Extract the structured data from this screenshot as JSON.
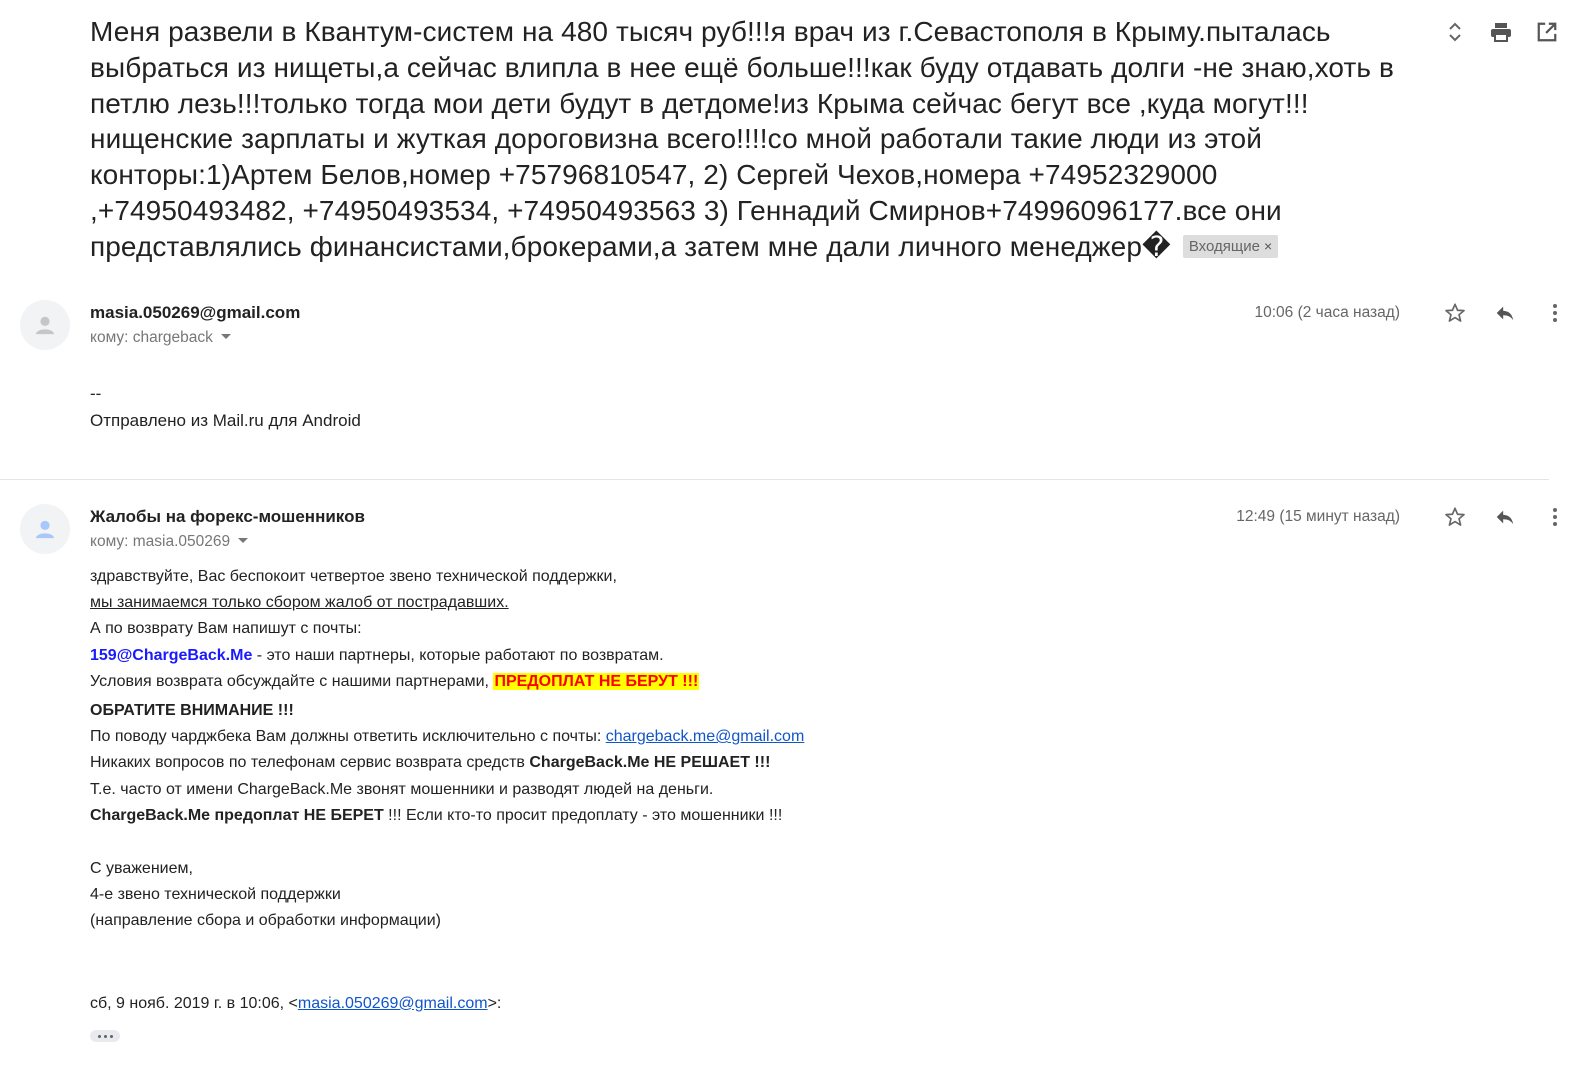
{
  "subject": {
    "text": "Меня развели в Квантум-систем на 480 тысяч руб!!!я врач из г.Севастополя в Крыму.пыталась выбраться из нищеты,а сейчас влипла в нее ещё больше!!!как буду отдавать долги -не знаю,хоть в петлю лезь!!!только тогда мои дети будут в детдоме!из Крыма сейчас бегут все ,куда могут!!!нищенские зарплаты и жуткая дороговизна всего!!!!со мной работали такие люди из этой конторы:1)Артем Белов,номер +75796810547, 2) Сергей Чехов,номера +74952329000 ,+74950493482, +74950493534, +74950493563 3) Геннадий Смирнов+74996096177.все они представлялись финансистами,брокерами,а затем мне дали личного менеджер�",
    "label": "Входящие",
    "label_close": "×"
  },
  "toolbar_icons": [
    "expand-collapse-icon",
    "print-icon",
    "open-in-new-window-icon"
  ],
  "messages": [
    {
      "sender": "masia.050269@gmail.com",
      "recipient": "кому: chargeback",
      "time": "10:06 (2 часа назад)",
      "body": {
        "line1": "--",
        "line2": "Отправлено из Mail.ru для Android"
      }
    },
    {
      "sender": "Жалобы на форекс-мошенников",
      "recipient": "кому: masia.050269",
      "time": "12:49 (15 минут назад)",
      "body": {
        "l1": "здравствуйте, Вас беспокоит четвертое звено технической поддержки,",
        "l2": "мы занимаемся только сбором жалоб от пострадавших.",
        "l3": "А по возврату Вам напишут с почты:",
        "l4_email": "159@ChargeBack.Me",
        "l4_text": " - это наши партнеры, которые работают по возвратам.",
        "l5_text": "Условия возврата обсуждайте с нашими партнерами, ",
        "l5_warn": "ПРЕДОПЛАТ НЕ БЕРУТ !!!",
        "l6": "ОБРАТИТЕ ВНИМАНИЕ !!!",
        "l7_text": "По поводу чарджбека Вам должны ответить исключительно с почты: ",
        "l7_link": "chargeback.me@gmail.com",
        "l8_text": "Никаких вопросов по телефонам сервис возврата средств ",
        "l8_bold": "ChargeBack.Me НЕ РЕШАЕТ",
        "l8_tail": " !!!",
        "l9": "Т.е. часто от имени ChargeBack.Me звонят мошенники и разводят людей на деньги.",
        "l10_bold": "ChargeBack.Me предоплат НЕ БЕРЕТ",
        "l10_tail": " !!! Если кто-то просит предоплату - это мошенники !!!",
        "s1": "С уважением,",
        "s2": "4-е звено технической поддержки",
        "s3": "(направление сбора и обработки информации)",
        "quote_prefix": "сб, 9 нояб. 2019 г. в 10:06, <",
        "quote_link": "masia.050269@gmail.com",
        "quote_suffix": ">:"
      }
    }
  ],
  "colors": {
    "partner_email": "#1a1aff",
    "warning_text": "#ff0000",
    "warning_highlight": "#ffff00",
    "link": "#1155cc"
  }
}
